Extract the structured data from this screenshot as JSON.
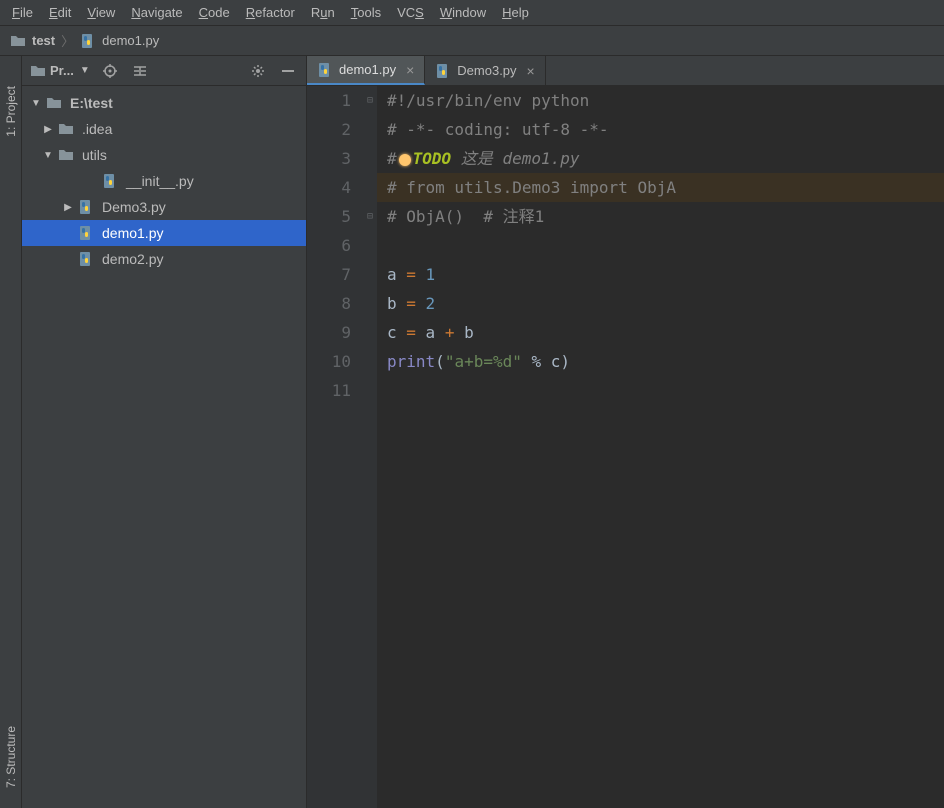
{
  "menu": {
    "items": [
      {
        "k": "F",
        "rest": "ile"
      },
      {
        "k": "E",
        "rest": "dit"
      },
      {
        "k": "V",
        "rest": "iew"
      },
      {
        "k": "N",
        "rest": "avigate"
      },
      {
        "k": "C",
        "rest": "ode"
      },
      {
        "k": "R",
        "rest": "efactor"
      },
      {
        "k": "",
        "rest": "R",
        "k2": "u",
        "rest2": "n"
      },
      {
        "k": "T",
        "rest": "ools"
      },
      {
        "k": "",
        "rest": "VC",
        "k2": "S",
        "rest2": ""
      },
      {
        "k": "W",
        "rest": "indow"
      },
      {
        "k": "H",
        "rest": "elp"
      }
    ]
  },
  "breadcrumb": {
    "root": "test",
    "file": "demo1.py"
  },
  "side": {
    "project": "1: Project",
    "structure": "7: Structure"
  },
  "panel": {
    "title": "Pr..."
  },
  "tree": {
    "root": "E:\\test",
    "idea": ".idea",
    "utils": "utils",
    "init": "__init__.py",
    "demo3": "Demo3.py",
    "demo1": "demo1.py",
    "demo2": "demo2.py"
  },
  "tabs": {
    "t1": "demo1.py",
    "t2": "Demo3.py"
  },
  "gutter": {
    "l1": "1",
    "l2": "2",
    "l3": "3",
    "l4": "4",
    "l5": "5",
    "l6": "6",
    "l7": "7",
    "l8": "8",
    "l9": "9",
    "l10": "10",
    "l11": "11"
  },
  "code": {
    "l1": "#!/usr/bin/env python",
    "l2": "# -*- coding: utf-8 -*-",
    "l3a": "#",
    "l3b": "TODO",
    "l3c": " 这是 demo1.py",
    "l4": "# from utils.Demo3 import ObjA",
    "l5": "# ObjA()  # 注释1",
    "l7a": "a ",
    "l7eq": "=",
    "l7b": " ",
    "l7n": "1",
    "l8a": "b ",
    "l8eq": "=",
    "l8b": " ",
    "l8n": "2",
    "l9a": "c ",
    "l9eq": "=",
    "l9b": " a ",
    "l9op": "+",
    "l9c": " b",
    "l10fn": "print",
    "l10a": "(",
    "l10s": "\"a+b=%d\"",
    "l10b": " % c)"
  }
}
